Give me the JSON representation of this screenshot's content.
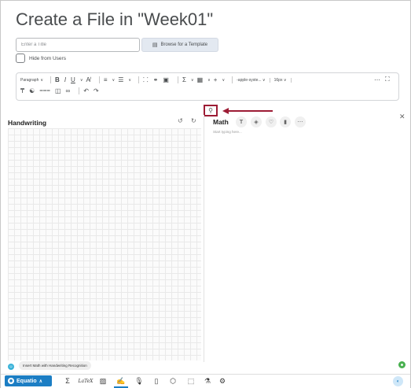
{
  "page": {
    "title": "Create a File in \"Week01\"",
    "title_placeholder": "Enter a Title",
    "template_button": "Browse for a Template",
    "hide_label": "Hide from Users"
  },
  "editor_toolbar": {
    "paragraph": "Paragraph",
    "bold": "B",
    "italic": "I",
    "underline": "U",
    "font_name": "-apple-syste...",
    "font_size": "16px",
    "more": "⋯",
    "sum": "Σ",
    "plus": "+"
  },
  "equatio": {
    "handwriting_title": "Handwriting",
    "math_title": "Math",
    "math_placeholder": "Start typing here...",
    "hint": "Insert Math with Handwriting Recognition",
    "brand": "Equatio",
    "latex": "LaTeX",
    "sigma": "Σ"
  },
  "colors": {
    "accent": "#1c7ec4",
    "highlight": "#9d1c35"
  }
}
